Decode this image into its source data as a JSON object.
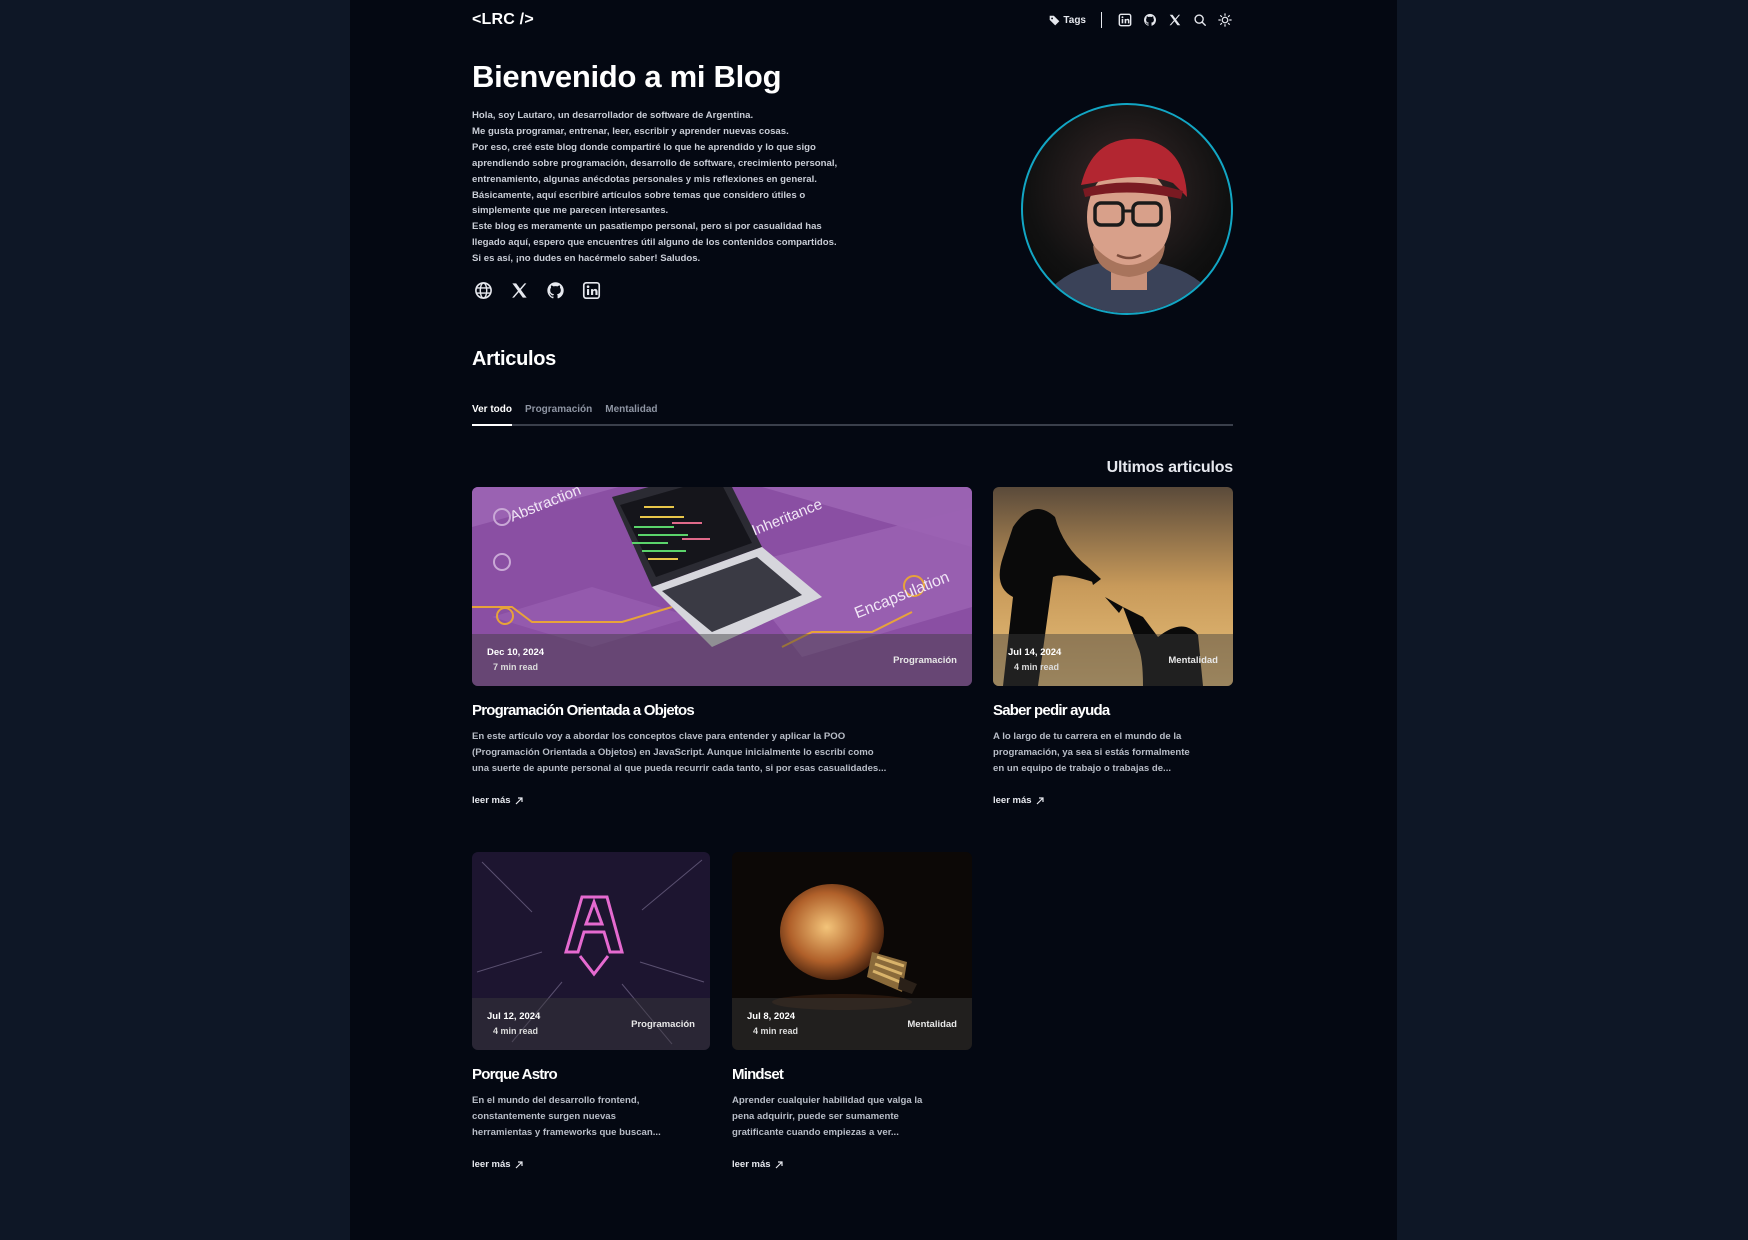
{
  "nav": {
    "logo": "<LRC />",
    "tags_label": "Tags",
    "icons": [
      "tag-icon",
      "linkedin-icon",
      "github-icon",
      "x-icon",
      "search-icon",
      "sun-icon"
    ]
  },
  "hero": {
    "title": "Bienvenido a mi Blog",
    "lines": [
      "Hola, soy Lautaro, un desarrollador de software de Argentina.",
      "Me gusta programar, entrenar, leer, escribir y aprender nuevas cosas.",
      "Por eso, creé este blog donde compartiré lo que he aprendido y lo que sigo",
      "aprendiendo sobre programación, desarrollo de software, crecimiento personal,",
      "entrenamiento, algunas anécdotas personales y mis reflexiones en general.",
      "Básicamente, aquí escribiré artículos sobre temas que considero útiles o",
      "simplemente que me parecen interesantes.",
      "Este blog es meramente un pasatiempo personal, pero si por casualidad has",
      "llegado aquí, espero que encuentres útil alguno de los contenidos compartidos.",
      "Si es así, ¡no dudes en hacérmelo saber! Saludos."
    ],
    "social_icons": [
      "globe-icon",
      "x-icon",
      "github-icon",
      "linkedin-icon"
    ]
  },
  "articles": {
    "title": "Articulos",
    "tabs": [
      "Ver todo",
      "Programación",
      "Mentalidad"
    ],
    "latest_label": "Ultimos articulos",
    "read_more": "leer más",
    "cards": [
      {
        "date": "Dec 10, 2024",
        "read_time": "7 min read",
        "category": "Programación",
        "title": "Programación Orientada a Objetos",
        "desc": [
          "En este artículo voy a abordar los conceptos clave para entender y aplicar la POO",
          "(Programación Orientada a Objetos) en JavaScript. Aunque inicialmente lo escribí como",
          "una suerte de apunte personal al que pueda recurrir cada tanto, si por esas casualidades..."
        ],
        "image_words": [
          "Abstraction",
          "Inheritance",
          "Encapsulation"
        ]
      },
      {
        "date": "Jul 14, 2024",
        "read_time": "4 min read",
        "category": "Mentalidad",
        "title": "Saber pedir ayuda",
        "desc": [
          "A lo largo de tu carrera en el mundo de la",
          "programación, ya sea si estás formalmente",
          "en un equipo de trabajo o trabajas de..."
        ]
      },
      {
        "date": "Jul 12, 2024",
        "read_time": "4 min read",
        "category": "Programación",
        "title": "Porque Astro",
        "desc": [
          "En el mundo del desarrollo frontend,",
          "constantemente surgen nuevas",
          "herramientas y frameworks que buscan..."
        ]
      },
      {
        "date": "Jul 8, 2024",
        "read_time": "4 min read",
        "category": "Mentalidad",
        "title": "Mindset",
        "desc": [
          "Aprender cualquier habilidad que valga la",
          "pena adquirir, puede ser sumamente",
          "gratificante cuando empiezas a ver..."
        ]
      }
    ]
  },
  "colors": {
    "page_bg": "#040812",
    "outer_bg": "#0e1726",
    "avatar_ring": "#12a6c4",
    "poo_card": "#8a4fa3"
  }
}
